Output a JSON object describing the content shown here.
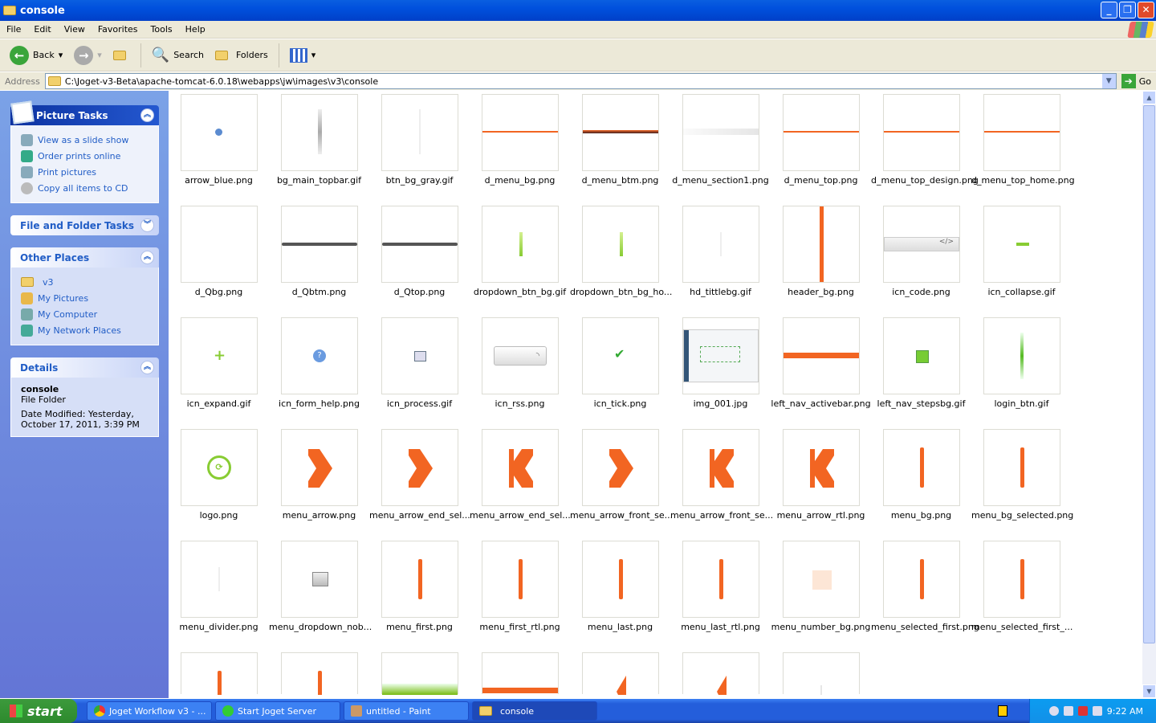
{
  "window": {
    "title": "console"
  },
  "menu": [
    "File",
    "Edit",
    "View",
    "Favorites",
    "Tools",
    "Help"
  ],
  "toolbar": {
    "back": "Back",
    "search": "Search",
    "folders": "Folders"
  },
  "address": {
    "label": "Address",
    "value": "C:\\Joget-v3-Beta\\apache-tomcat-6.0.18\\webapps\\jw\\images\\v3\\console",
    "go": "Go"
  },
  "sidebar": {
    "picture_tasks": {
      "title": "Picture Tasks",
      "items": [
        "View as a slide show",
        "Order prints online",
        "Print pictures",
        "Copy all items to CD"
      ]
    },
    "file_folder_tasks": {
      "title": "File and Folder Tasks"
    },
    "other_places": {
      "title": "Other Places",
      "items": [
        "v3",
        "My Pictures",
        "My Computer",
        "My Network Places"
      ]
    },
    "details": {
      "title": "Details",
      "name": "console",
      "type": "File Folder",
      "modified": "Date Modified: Yesterday, October 17, 2011, 3:39 PM"
    }
  },
  "files": [
    {
      "name": "arrow_blue.png",
      "thumb": "dot-blue"
    },
    {
      "name": "bg_main_topbar.gif",
      "thumb": "vline-gray"
    },
    {
      "name": "btn_bg_gray.gif",
      "thumb": "vline-light"
    },
    {
      "name": "d_menu_bg.png",
      "thumb": "hline-orange"
    },
    {
      "name": "d_menu_btm.png",
      "thumb": "hline-dark"
    },
    {
      "name": "d_menu_section1.png",
      "thumb": "hline-lightgray"
    },
    {
      "name": "d_menu_top.png",
      "thumb": "hline-orange"
    },
    {
      "name": "d_menu_top_design.png",
      "thumb": "hline-orange"
    },
    {
      "name": "d_menu_top_home.png",
      "thumb": "hline-orange"
    },
    {
      "name": "d_Qbg.png",
      "thumb": "blank"
    },
    {
      "name": "d_Qbtm.png",
      "thumb": "hbar-gray"
    },
    {
      "name": "d_Qtop.png",
      "thumb": "hbar-gray"
    },
    {
      "name": "dropdown_btn_bg.gif",
      "thumb": "vline-green"
    },
    {
      "name": "dropdown_btn_bg_ho...",
      "thumb": "vline-green"
    },
    {
      "name": "hd_tittlebg.gif",
      "thumb": "vline-faint"
    },
    {
      "name": "header_bg.png",
      "thumb": "vbar-orange-full"
    },
    {
      "name": "icn_code.png",
      "thumb": "code-bar"
    },
    {
      "name": "icn_collapse.gif",
      "thumb": "minus-green"
    },
    {
      "name": "icn_expand.gif",
      "thumb": "plus-green"
    },
    {
      "name": "icn_form_help.png",
      "thumb": "help-circle"
    },
    {
      "name": "icn_process.gif",
      "thumb": "process"
    },
    {
      "name": "icn_rss.png",
      "thumb": "rss-bar"
    },
    {
      "name": "icn_tick.png",
      "thumb": "tick"
    },
    {
      "name": "img_001.jpg",
      "thumb": "screenshot"
    },
    {
      "name": "left_nav_activebar.png",
      "thumb": "hbar-orange"
    },
    {
      "name": "left_nav_stepsbg.gif",
      "thumb": "square-green"
    },
    {
      "name": "login_btn.gif",
      "thumb": "vline-green-tall"
    },
    {
      "name": "logo.png",
      "thumb": "logo"
    },
    {
      "name": "menu_arrow.png",
      "thumb": "arrow-right"
    },
    {
      "name": "menu_arrow_end_sel...",
      "thumb": "arrow-right"
    },
    {
      "name": "menu_arrow_end_sel...",
      "thumb": "arrow-left"
    },
    {
      "name": "menu_arrow_front_se...",
      "thumb": "arrow-right"
    },
    {
      "name": "menu_arrow_front_se...",
      "thumb": "arrow-left"
    },
    {
      "name": "menu_arrow_rtl.png",
      "thumb": "arrow-left"
    },
    {
      "name": "menu_bg.png",
      "thumb": "vbar-orange"
    },
    {
      "name": "menu_bg_selected.png",
      "thumb": "vbar-orange"
    },
    {
      "name": "menu_divider.png",
      "thumb": "vline-faint"
    },
    {
      "name": "menu_dropdown_nob...",
      "thumb": "square-gray"
    },
    {
      "name": "menu_first.png",
      "thumb": "vbar-orange"
    },
    {
      "name": "menu_first_rtl.png",
      "thumb": "vbar-orange"
    },
    {
      "name": "menu_last.png",
      "thumb": "vbar-orange"
    },
    {
      "name": "menu_last_rtl.png",
      "thumb": "vbar-orange"
    },
    {
      "name": "menu_number_bg.png",
      "thumb": "square-peach"
    },
    {
      "name": "menu_selected_first.png",
      "thumb": "vbar-orange"
    },
    {
      "name": "menu_selected_first_...",
      "thumb": "vbar-orange"
    },
    {
      "name": "",
      "thumb": "vbar-orange"
    },
    {
      "name": "",
      "thumb": "vbar-orange"
    },
    {
      "name": "",
      "thumb": "green-gradient"
    },
    {
      "name": "",
      "thumb": "hbar-orange-top"
    },
    {
      "name": "",
      "thumb": "half-arrow"
    },
    {
      "name": "",
      "thumb": "half-arrow"
    },
    {
      "name": "",
      "thumb": "vline-faint"
    }
  ],
  "taskbar": {
    "start": "start",
    "tasks": [
      "Joget Workflow v3 - ...",
      "Start Joget Server",
      "untitled - Paint",
      "console"
    ],
    "clock": "9:22 AM"
  }
}
